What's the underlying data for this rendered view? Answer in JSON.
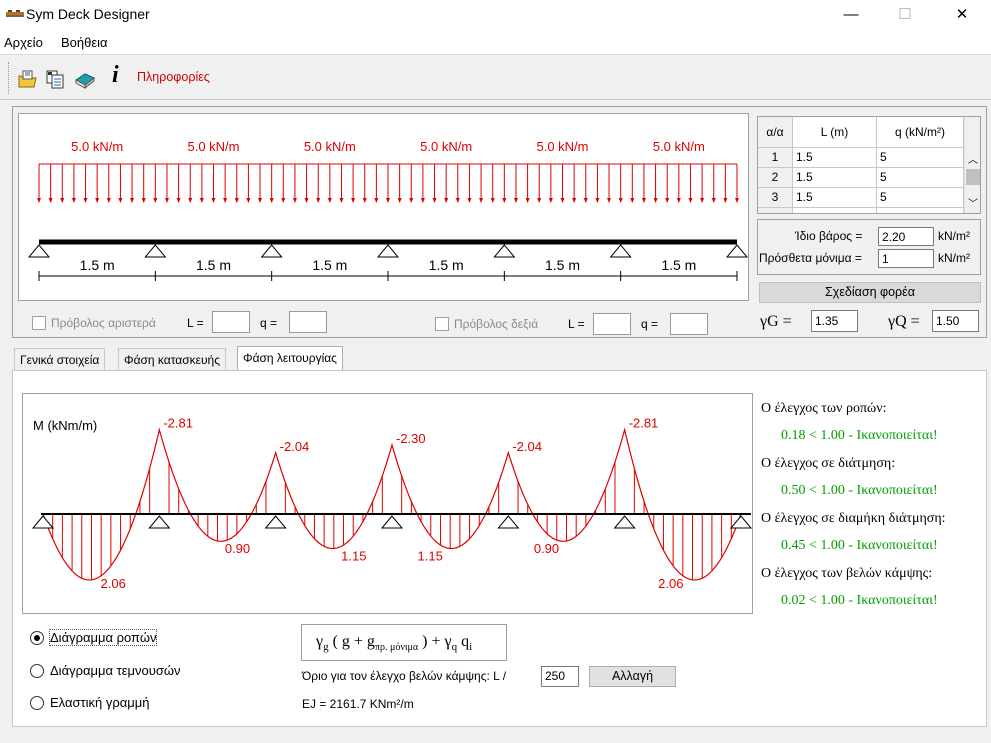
{
  "window": {
    "title": "Sym Deck Designer",
    "controls": {
      "minimize": "—",
      "maximize": "☐",
      "close": "✕"
    }
  },
  "menu": {
    "file": "Αρχείο",
    "help": "Βοήθεια"
  },
  "toolbar": {
    "icons": [
      "open-file-icon",
      "save-table-icon",
      "book-icon",
      "info-icon"
    ],
    "info_glyph": "i",
    "info_label": "Πληροφορίες"
  },
  "beam": {
    "loads": [
      "5.0 kN/m",
      "5.0 kN/m",
      "5.0 kN/m",
      "5.0 kN/m",
      "5.0 kN/m",
      "5.0 kN/m"
    ],
    "spans": [
      "1.5 m",
      "1.5 m",
      "1.5 m",
      "1.5 m",
      "1.5 m",
      "1.5 m"
    ]
  },
  "span_table": {
    "headers": [
      "α/α",
      "L (m)",
      "q (kN/m²)"
    ],
    "rows": [
      {
        "n": "1",
        "L": "1.5",
        "q": "5"
      },
      {
        "n": "2",
        "L": "1.5",
        "q": "5"
      },
      {
        "n": "3",
        "L": "1.5",
        "q": "5"
      }
    ]
  },
  "weights": {
    "self_label": "Ίδιο βάρος =",
    "self_value": "2.20",
    "self_unit": "kN/m²",
    "dead_label": "Πρόσθετα μόνιμα =",
    "dead_value": "1",
    "dead_unit": "kN/m²"
  },
  "draw_button": "Σχεδίαση φορέα",
  "cantilever": {
    "left_label": "Πρόβολος αριστερά",
    "right_label": "Πρόβολος δεξιά",
    "L_label": "L =",
    "q_label": "q ="
  },
  "factors": {
    "gG_label": "γG =",
    "gG_value": "1.35",
    "gQ_label": "γQ =",
    "gQ_value": "1.50"
  },
  "tabs": [
    "Γενικά στοιχεία",
    "Φάση κατασκευής",
    "Φάση λειτουργίας"
  ],
  "active_tab": 2,
  "moment_diagram": {
    "ylabel": "M (kNm/m)",
    "support_moments": [
      "-2.81",
      "-2.04",
      "-2.30",
      "-2.04",
      "-2.81"
    ],
    "span_moments": [
      "2.06",
      "0.90",
      "1.15",
      "1.15",
      "0.90",
      "2.06"
    ]
  },
  "checks": [
    {
      "label": "Ο έλεγχος των ροπών:",
      "result": "0.18 < 1.00 - Ικανοποιείται!"
    },
    {
      "label": "Ο έλεγχος σε διάτμηση:",
      "result": "0.50 < 1.00 - Ικανοποιείται!"
    },
    {
      "label": "Ο έλεγχος σε διαμήκη διάτμηση:",
      "result": "0.45 < 1.00 - Ικανοποιείται!"
    },
    {
      "label": "Ο έλεγχος των βελών κάμψης:",
      "result": "0.02 < 1.00 - Ικανοποιείται!"
    }
  ],
  "diagram_options": {
    "selected": 0,
    "items": [
      "Διάγραμμα ροπών",
      "Διάγραμμα τεμνουσών",
      "Ελαστική γραμμή"
    ]
  },
  "formula": {
    "gamma_g": "γ",
    "sub_g": "g",
    "middle": "( g + g",
    "sub_perm": "πρ. μόνιμα",
    "close": ") + γ",
    "sub_q": "q",
    "qi": "q",
    "sub_i": "i"
  },
  "deflection": {
    "label": "Όριο για τον έλεγχο βελών κάμψης: L /",
    "value": "250",
    "button": "Αλλαγή"
  },
  "stiffness": "EJ = 2161.7 KNm²/m",
  "colors": {
    "accent_red": "#e00000",
    "ok_green": "#00a000"
  }
}
